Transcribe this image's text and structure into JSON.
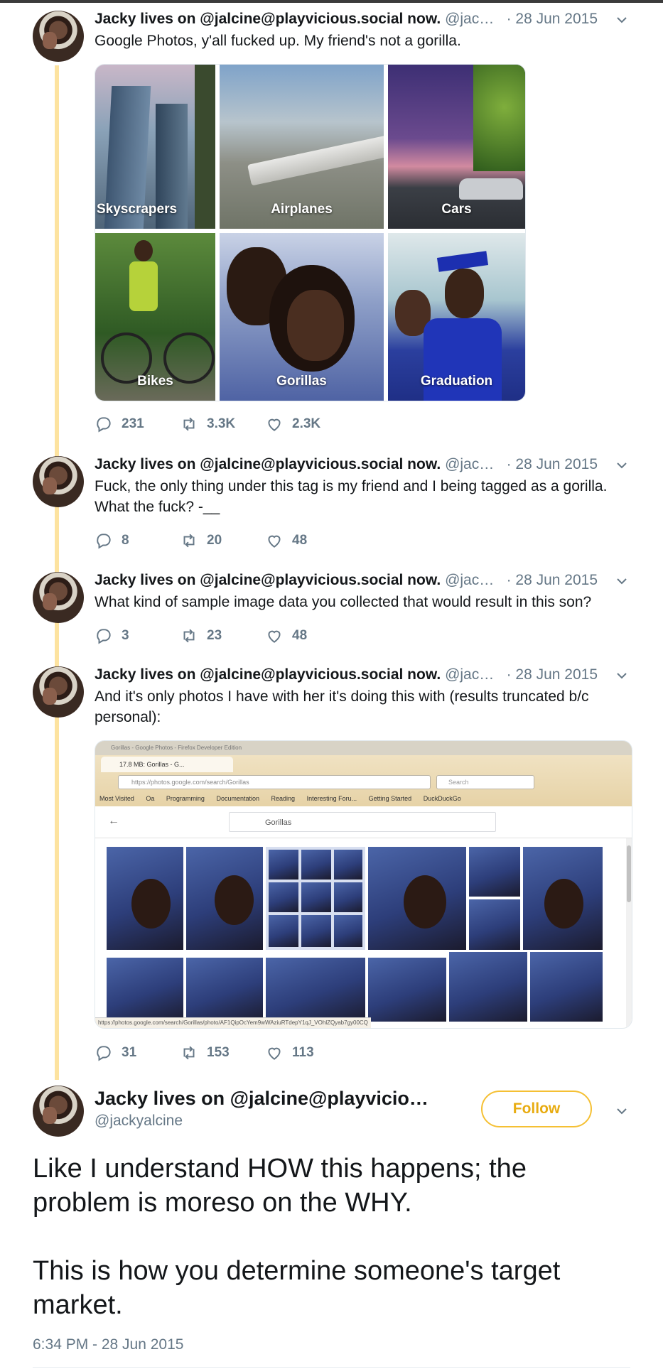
{
  "thread": [
    {
      "name": "Jacky lives on @jalcine@playvicious.social now.",
      "handle": "@jac…",
      "date": "· 28 Jun 2015",
      "text_lines": [
        "Google Photos, y'all fucked up. My friend's not a gorilla."
      ],
      "replies": "231",
      "retweets": "3.3K",
      "likes": "2.3K"
    },
    {
      "name": "Jacky lives on @jalcine@playvicious.social now.",
      "handle": "@jac…",
      "date": "· 28 Jun 2015",
      "text_lines": [
        "Fuck, the only thing under this tag is my friend and I being tagged as a gorilla.",
        "What the fuck? -__"
      ],
      "replies": "8",
      "retweets": "20",
      "likes": "48"
    },
    {
      "name": "Jacky lives on @jalcine@playvicious.social now.",
      "handle": "@jac…",
      "date": "· 28 Jun 2015",
      "text_lines": [
        "What kind of sample image data you collected that would result in this son?"
      ],
      "replies": "3",
      "retweets": "23",
      "likes": "48"
    },
    {
      "name": "Jacky lives on @jalcine@playvicious.social now.",
      "handle": "@jac…",
      "date": "· 28 Jun 2015",
      "text_lines": [
        "And it's only photos I have with her it's doing this with (results truncated b/c",
        "personal):"
      ],
      "replies": "31",
      "retweets": "153",
      "likes": "113"
    }
  ],
  "photo_grid": {
    "labels": [
      "Skyscrapers",
      "Airplanes",
      "Cars",
      "Bikes",
      "Gorillas",
      "Graduation"
    ]
  },
  "browser_shot": {
    "window_title": "Gorillas - Google Photos - Firefox Developer Edition",
    "tab_label": "17.8 MB: Gorillas - G...",
    "url": "https://photos.google.com/search/Gorillas",
    "search_placeholder": "Search",
    "bookmarks": [
      "Most Visited",
      "Oa",
      "Programming",
      "Documentation",
      "Reading",
      "Interesting Foru...",
      "Getting Started",
      "DuckDuckGo"
    ],
    "gp_search_value": "Gorillas",
    "status_url": "https://photos.google.com/search/Gorillas/photo/AF1QipOcYem9wWAziuRTdepY1qJ_VOhlZQyab7gy00CQ"
  },
  "focused": {
    "name": "Jacky lives on @jalcine@playvicio…",
    "handle": "@jackyalcine",
    "follow_label": "Follow",
    "text_lines": [
      "Like I understand HOW this happens; the",
      "problem is moreso on the WHY.",
      "This is how you determine someone's target",
      "market."
    ],
    "timestamp": "6:34 PM - 28 Jun 2015"
  },
  "colors": {
    "accent": "#f5c034",
    "thread_line": "#fde3a0",
    "secondary_text": "#657786"
  },
  "icons": [
    "reply-icon",
    "retweet-icon",
    "like-icon",
    "chevron-down-icon"
  ]
}
